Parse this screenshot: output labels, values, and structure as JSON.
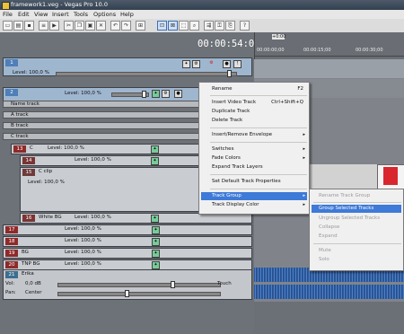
{
  "window": {
    "title": "framework1.veg - Vegas Pro 10.0"
  },
  "menubar": {
    "items": [
      "File",
      "Edit",
      "View",
      "Insert",
      "Tools",
      "Options",
      "Help"
    ]
  },
  "timecode": "00:00:54:07",
  "ruler": {
    "ticks": [
      "00:00:00;00",
      "00:00:15;00",
      "00:00:30;00"
    ],
    "marker": "+0:00"
  },
  "tracks": {
    "t1": {
      "num": "1",
      "level": "Level: 100,0 %"
    },
    "t2": {
      "num": "2",
      "level": "Level: 100,0 %"
    },
    "groups": [
      "Name track",
      "A track",
      "B track",
      "C track"
    ],
    "t13": {
      "num": "13",
      "name": "C",
      "level": "Level: 100,0 %"
    },
    "t14": {
      "num": "14",
      "level": "Level: 100,0 %"
    },
    "t15": {
      "num": "15",
      "name": "C clip",
      "level": "Level: 100,0 %"
    },
    "t16": {
      "num": "16",
      "name": "White BG",
      "level": "Level: 100,0 %"
    },
    "t17": {
      "num": "17",
      "level": "Level: 100,0 %"
    },
    "t18": {
      "num": "18",
      "level": "Level: 100,0 %"
    },
    "t19": {
      "num": "19",
      "name": "BG",
      "level": "Level: 100,0 %"
    },
    "t20": {
      "num": "20",
      "name": "TNP BG",
      "level": "Level: 100,0 %"
    },
    "t21": {
      "num": "21",
      "name": "Erika",
      "vol": "0,0 dB",
      "pan_label": "Pan:",
      "vol_label": "Vol:",
      "pan": "Center",
      "touch": "Touch"
    }
  },
  "context_menu": {
    "rename": "Rename",
    "rename_sc": "F2",
    "insert_video": "Insert Video Track",
    "insert_video_sc": "Ctrl+Shift+Q",
    "duplicate": "Duplicate Track",
    "delete": "Delete Track",
    "envelope": "Insert/Remove Envelope",
    "switches": "Switches",
    "fade_colors": "Fade Colors",
    "expand_layers": "Expand Track Layers",
    "default_props": "Set Default Track Properties",
    "track_group": "Track Group",
    "display_color": "Track Display Color"
  },
  "submenu": {
    "rename_group": "Rename Track Group",
    "group_selected": "Group Selected Tracks",
    "ungroup_selected": "Ungroup Selected Tracks",
    "collapse": "Collapse",
    "expand": "Expand",
    "mute": "Mute",
    "solo": "Solo"
  },
  "colors": {
    "highlight": "#3e7ad8",
    "timeline_bg": "#80848a",
    "track_bg": "#c9ccd1"
  }
}
